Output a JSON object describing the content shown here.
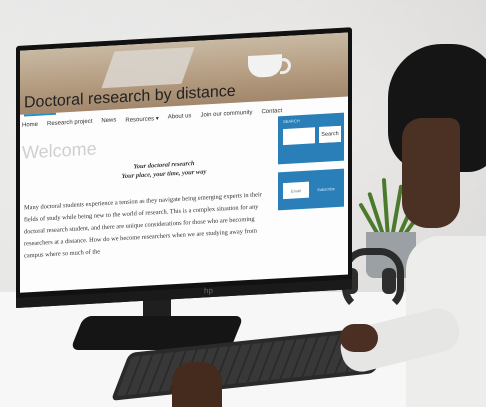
{
  "site": {
    "title": "Doctoral research by distance",
    "nav": [
      "Home",
      "Research project",
      "News",
      "Resources ▾",
      "About us",
      "Join our community",
      "Contact"
    ],
    "welcome": "Welcome",
    "tagline_1": "Your doctoral research",
    "tagline_2": "Your place, your time, your way",
    "body": "Many doctoral students experience a tension as they navigate being emerging experts in their fields of study while being new to the world of research. This is a complex situation for any doctoral research student, and there are unique considerations for those who are becoming researchers at a distance. How do we become researchers when we are studying away from campus where so much of the",
    "search_label": "SEARCH",
    "search_button": "Search",
    "subscribe_placeholder": "Email",
    "subscribe_button": "Subscribe"
  },
  "monitor": {
    "logo": "hp"
  },
  "colors": {
    "sidebar_blue": "#2a7fb8",
    "accent": "#2a8ec7"
  }
}
